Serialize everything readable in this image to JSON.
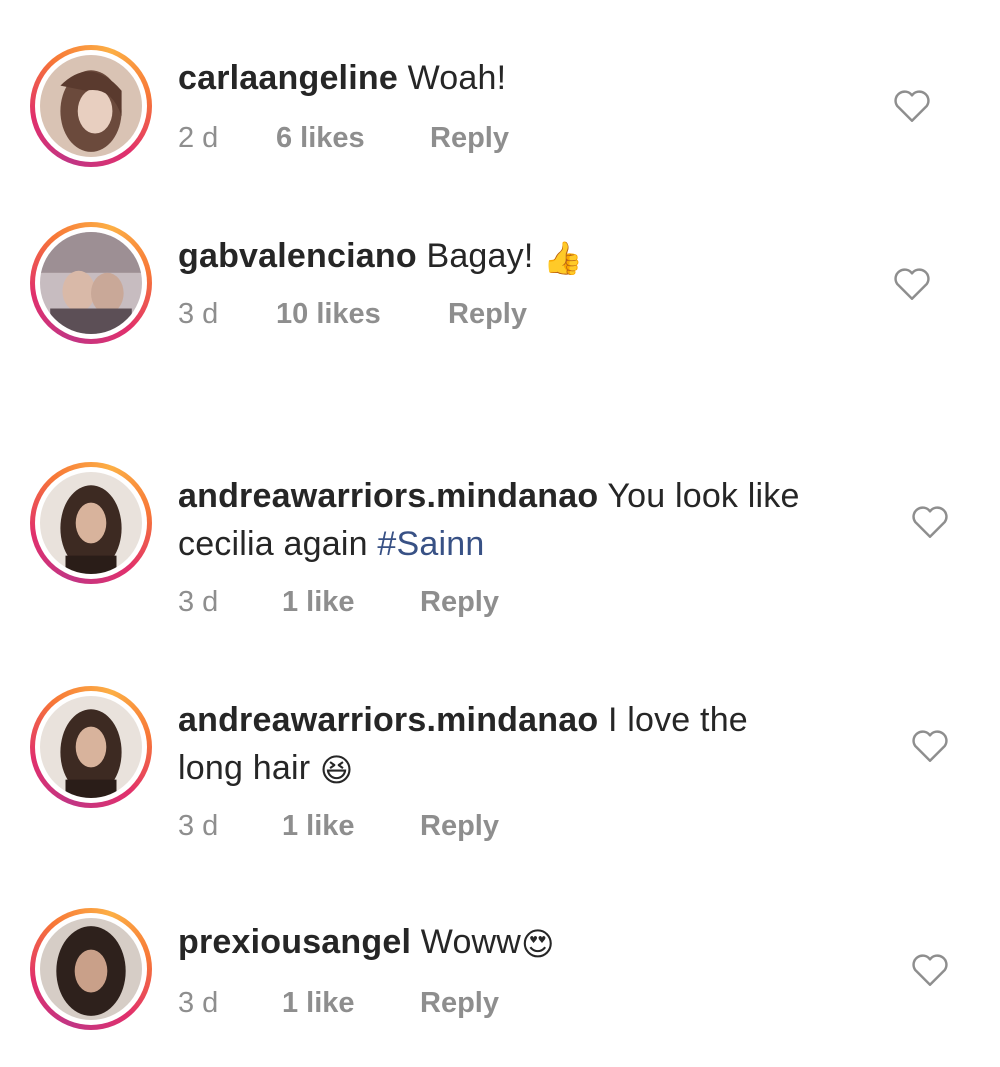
{
  "comments": [
    {
      "username": "carlaangeline",
      "text": " Woah!",
      "text2": "",
      "emoji": "",
      "time": "2 d",
      "likes": "6 likes",
      "reply": "Reply",
      "avatar_color": "#6b4a3c",
      "heart_icon": "heart-outline-icon"
    },
    {
      "username": "gabvalenciano",
      "text": " Bagay! ",
      "text2": "",
      "emoji": "👍",
      "time": "3 d",
      "likes": "10 likes",
      "reply": "Reply",
      "avatar_color": "#8c7a82",
      "heart_icon": "heart-outline-icon"
    },
    {
      "username": "andreawarriors.mindanao",
      "text": " You look like",
      "text2_prefix": "cecilia again ",
      "hashtag": "#Sainn",
      "time": "3 d",
      "likes": "1 like",
      "reply": "Reply",
      "avatar_color": "#3d2a22",
      "heart_icon": "heart-outline-icon"
    },
    {
      "username": "andreawarriors.mindanao",
      "text": " I love the",
      "text2_prefix": "long hair ",
      "emoji": "😆",
      "time": "3 d",
      "likes": "1 like",
      "reply": "Reply",
      "avatar_color": "#3d2a22",
      "heart_icon": "heart-outline-icon"
    },
    {
      "username": "prexiousangel",
      "text": " Woww",
      "emoji": "😍",
      "time": "3 d",
      "likes": "1 like",
      "reply": "Reply",
      "avatar_color": "#2e211c",
      "heart_icon": "heart-outline-icon"
    }
  ]
}
